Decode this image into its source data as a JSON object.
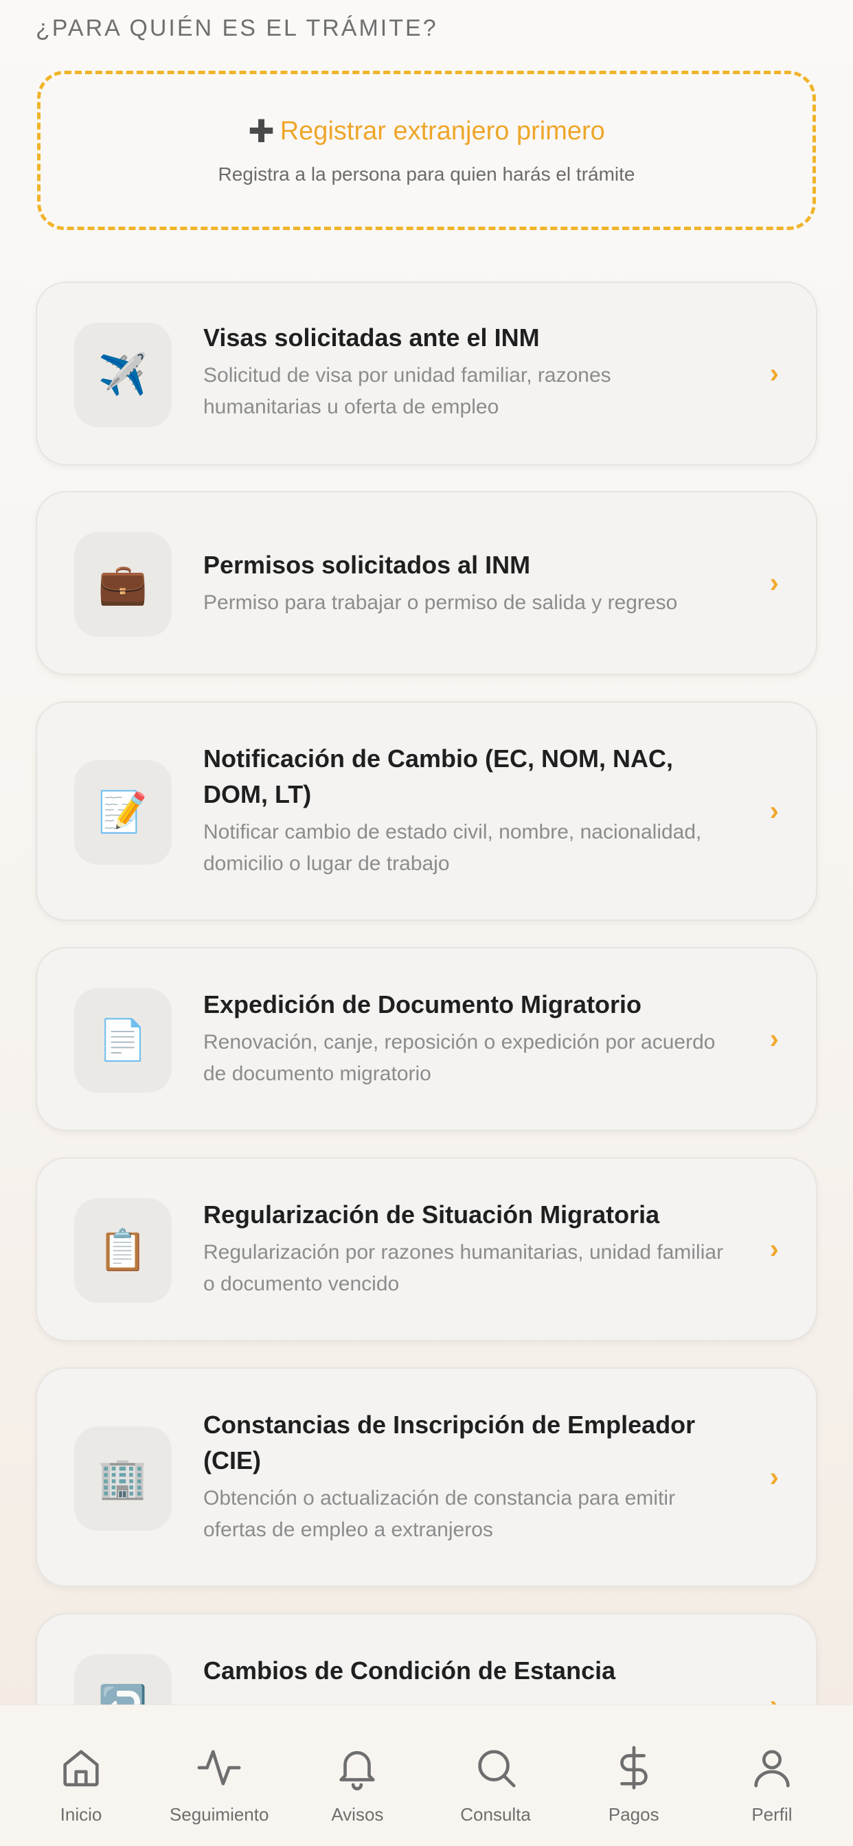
{
  "header": {
    "section_title": "¿PARA QUIÉN ES EL TRÁMITE?"
  },
  "register": {
    "icon": "plus-icon",
    "label": "Registrar extranjero primero",
    "subtitle": "Registra a la persona para quien harás el trámite",
    "accent_color": "#f0b429"
  },
  "cards": [
    {
      "icon": "airplane-icon",
      "icon_glyph": "✈️",
      "title": "Visas solicitadas ante el INM",
      "description": "Solicitud de visa por unidad familiar, razones humanitarias u oferta de empleo"
    },
    {
      "icon": "briefcase-icon",
      "icon_glyph": "💼",
      "title": "Permisos solicitados al INM",
      "description": "Permiso para trabajar o permiso de salida y regreso"
    },
    {
      "icon": "memo-icon",
      "icon_glyph": "📝",
      "title": "Notificación de Cambio (EC, NOM, NAC, DOM, LT)",
      "description": "Notificar cambio de estado civil, nombre, nacionalidad, domicilio o lugar de trabajo"
    },
    {
      "icon": "document-icon",
      "icon_glyph": "📄",
      "title": "Expedición de Documento Migratorio",
      "description": "Renovación, canje, reposición o expedición por acuerdo de documento migratorio"
    },
    {
      "icon": "clipboard-icon",
      "icon_glyph": "📋",
      "title": "Regularización de Situación Migratoria",
      "description": "Regularización por razones humanitarias, unidad familiar o documento vencido"
    },
    {
      "icon": "office-building-icon",
      "icon_glyph": "🏢",
      "title": "Constancias de Inscripción de Empleador (CIE)",
      "description": "Obtención o actualización de constancia para emitir ofertas de empleo a extranjeros"
    },
    {
      "icon": "return-arrow-icon",
      "icon_glyph": "↩️",
      "title": "Cambios de Condición de Estancia",
      "description": ""
    }
  ],
  "tabbar": {
    "items": [
      {
        "label": "Inicio",
        "icon": "home-icon"
      },
      {
        "label": "Seguimiento",
        "icon": "activity-icon"
      },
      {
        "label": "Avisos",
        "icon": "bell-icon"
      },
      {
        "label": "Consulta",
        "icon": "search-icon"
      },
      {
        "label": "Pagos",
        "icon": "dollar-icon"
      },
      {
        "label": "Perfil",
        "icon": "user-icon"
      }
    ]
  },
  "colors": {
    "accent": "#f0a92c",
    "background": "#faf9f7"
  }
}
